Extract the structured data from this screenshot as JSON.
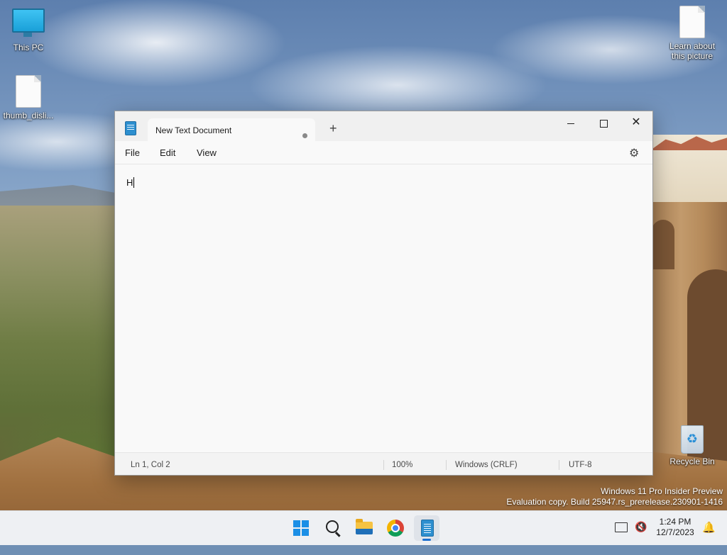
{
  "desktop": {
    "icons": [
      {
        "label": "This PC"
      },
      {
        "label": "thumb_disli..."
      },
      {
        "label": "Learn about this picture"
      },
      {
        "label": "Recycle Bin"
      }
    ],
    "watermark": {
      "line1": "Windows 11 Pro Insider Preview",
      "line2": "Evaluation copy. Build 25947.rs_prerelease.230901-1416"
    }
  },
  "window": {
    "app_icon": "notepad-icon",
    "tab_title": "New Text Document",
    "tab_modified_indicator": "•",
    "new_tab": "+",
    "controls": {
      "minimize": "minimize-icon",
      "maximize": "maximize-icon",
      "close": "✕"
    },
    "menu": {
      "file": "File",
      "edit": "Edit",
      "view": "View",
      "settings_icon": "gear-icon"
    },
    "editor": {
      "content": "H"
    },
    "status": {
      "position": "Ln 1, Col 2",
      "zoom": "100%",
      "line_ending": "Windows (CRLF)",
      "encoding": "UTF-8"
    }
  },
  "taskbar": {
    "items": [
      "windows-start-icon",
      "search-icon",
      "file-explorer-icon",
      "chrome-icon",
      "notepad-icon"
    ],
    "active_item": "notepad-icon",
    "time": "1:24 PM",
    "date": "12/7/2023",
    "accent": "#1b6fd0"
  }
}
